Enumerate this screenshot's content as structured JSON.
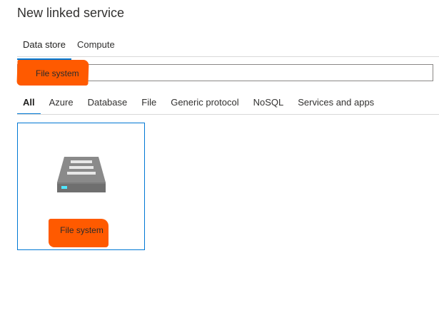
{
  "dialog": {
    "title": "New linked service"
  },
  "top_tabs": [
    {
      "label": "Data store",
      "active": true
    },
    {
      "label": "Compute",
      "active": false
    }
  ],
  "search": {
    "value": "File system",
    "placeholder": "",
    "highlight_color": "#ff5a00"
  },
  "category_tabs": [
    {
      "label": "All",
      "active": true
    },
    {
      "label": "Azure",
      "active": false
    },
    {
      "label": "Database",
      "active": false
    },
    {
      "label": "File",
      "active": false
    },
    {
      "label": "Generic protocol",
      "active": false
    },
    {
      "label": "NoSQL",
      "active": false
    },
    {
      "label": "Services and apps",
      "active": false
    }
  ],
  "results": [
    {
      "label": "File system",
      "icon": "file-system-server-icon",
      "selected": true
    }
  ],
  "colors": {
    "accent": "#0078d4",
    "highlight": "#ff5a00"
  }
}
